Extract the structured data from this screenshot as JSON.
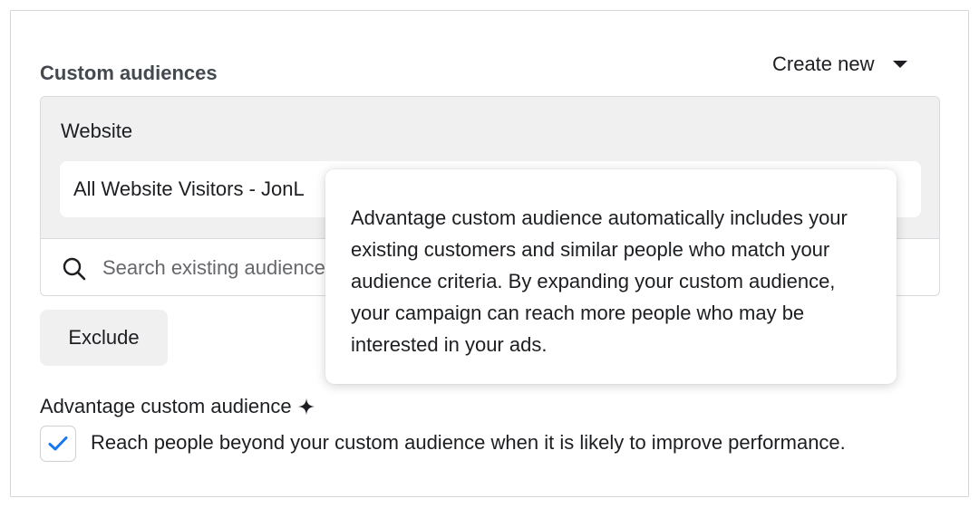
{
  "section": {
    "title": "Custom audiences",
    "create_new_label": "Create new"
  },
  "audience_group": {
    "label": "Website",
    "selected_audience": "All Website Visitors - JonL"
  },
  "search": {
    "placeholder": "Search existing audiences"
  },
  "exclude_label": "Exclude",
  "advantage": {
    "title": "Advantage custom audience",
    "checkbox_label": "Reach people beyond your custom audience when it is likely to improve performance.",
    "checked": true
  },
  "tooltip": {
    "text": "Advantage custom audience automatically includes your existing customers and similar people who match your audience criteria. By expanding your custom audience, your campaign can reach more people who may be interested in your ads."
  },
  "icons": {
    "search": "search-icon",
    "caret": "caret-down-icon",
    "sparkle": "sparkle-icon",
    "check": "checkmark-icon"
  },
  "colors": {
    "accent": "#1877f2",
    "panel_bg": "#f0f0f1",
    "border": "#d8dadd"
  }
}
